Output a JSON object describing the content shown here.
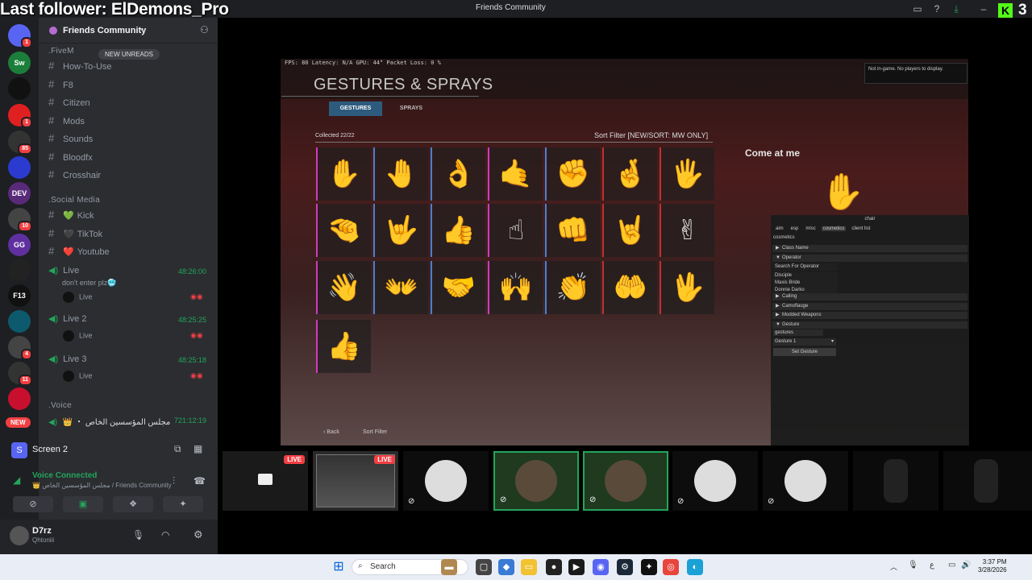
{
  "overlay": {
    "last_follower": "Last follower: ElDemons_Pro",
    "kick_count": "3"
  },
  "window": {
    "title": "Friends Community"
  },
  "guild": {
    "name": "Friends Community",
    "new_unreads": "NEW UNREADS"
  },
  "servers": [
    {
      "label": "",
      "badge": "1",
      "color": "#5865f2"
    },
    {
      "label": "Sw",
      "badge": "",
      "color": "#1b7f3b"
    },
    {
      "label": "",
      "badge": "",
      "color": "#111"
    },
    {
      "label": "",
      "badge": "1",
      "color": "#e02020"
    },
    {
      "label": "",
      "badge": "85",
      "color": "#333"
    },
    {
      "label": "",
      "badge": "",
      "color": "#2b3bd0"
    },
    {
      "label": "DEV",
      "badge": "",
      "color": "#5a2a7a"
    },
    {
      "label": "",
      "badge": "10",
      "color": "#444"
    },
    {
      "label": "GG",
      "badge": "",
      "color": "#6030a0"
    },
    {
      "label": "",
      "badge": "",
      "color": "#222"
    },
    {
      "label": "F13",
      "badge": "",
      "color": "#111"
    },
    {
      "label": "",
      "badge": "",
      "color": "#0d5a6e"
    },
    {
      "label": "",
      "badge": "4",
      "color": "#444"
    },
    {
      "label": "",
      "badge": "11",
      "color": "#333"
    },
    {
      "label": "",
      "badge": "",
      "color": "#c8102e"
    }
  ],
  "new_pill": "NEW",
  "categories": {
    "fivem": ".FiveM",
    "social": ".Social Media",
    "voice": ".Voice"
  },
  "fivem_channels": [
    "How-To-Use",
    "F8",
    "Citizen",
    "Mods",
    "Sounds",
    "Bloodfx",
    "Crosshair"
  ],
  "social_channels": [
    {
      "label": "Kick",
      "emoji": "💚"
    },
    {
      "label": "TikTok",
      "emoji": "🖤"
    },
    {
      "label": "Youtube",
      "emoji": "❤️"
    }
  ],
  "voice_channels": [
    {
      "name": "Live",
      "time": "48:26:00",
      "subtitle": "don't enter plz🥶",
      "member": "Live"
    },
    {
      "name": "Live 2",
      "time": "48:25:25",
      "subtitle": "",
      "member": "Live"
    },
    {
      "name": "Live 3",
      "time": "48:25:18",
      "subtitle": "",
      "member": "Live"
    }
  ],
  "voice_room": {
    "name": "👑 ・ مجلس المؤسسين الخاص",
    "time": "721:12:19"
  },
  "screen_panel": {
    "label": "Screen 2"
  },
  "voice_status": {
    "title": "Voice Connected",
    "channel": "👑 مجلس المؤسسين الخاص / Friends Community"
  },
  "user": {
    "name": "D7rz",
    "status": "Qhtoniii"
  },
  "game": {
    "hud": "FPS: 80    Latency: N/A    GPU: 44°    Packet Loss: 0 %",
    "title": "GESTURES & SPRAYS",
    "tabs": [
      "GESTURES",
      "SPRAYS"
    ],
    "collected": "Collected 22/22",
    "sort_filter": "Sort Filter [NEW/SORT: MW ONLY]",
    "selected_name": "Come at me",
    "status_box": "Not in-game. No players to display.",
    "back": "Back",
    "sort": "Sort Filter",
    "gesture_icons": [
      "✋",
      "🤚",
      "👌",
      "🤙",
      "✊",
      "🤞",
      "🖐",
      "🤏",
      "🤟",
      "👍",
      "☝",
      "👊",
      "🤘",
      "✌",
      "👋",
      "👐",
      "🤝",
      "🙌",
      "👏",
      "🤲",
      "🖖",
      "👍"
    ]
  },
  "cheat_menu": {
    "title": "chair",
    "tabs": [
      "aim",
      "esp",
      "misc",
      "cosmetics",
      "client list"
    ],
    "section": "cosmetics",
    "rows": [
      "Class Name",
      "Operator",
      "Search For Operator",
      "Disciple",
      "Maxis Bride",
      "Donnie Darko",
      "Calling",
      "Camoflauge",
      "Modded Weapons",
      "Gesture"
    ],
    "gesture_input": "gestures",
    "gesture_select": "Gesture 1",
    "set_button": "Set Gesture"
  },
  "thumbnails": [
    {
      "live": "LIVE",
      "kind": "screen"
    },
    {
      "live": "LIVE",
      "kind": "game"
    },
    {
      "live": "",
      "kind": "avatar"
    },
    {
      "live": "",
      "kind": "avatar"
    },
    {
      "live": "",
      "kind": "avatar"
    },
    {
      "live": "",
      "kind": "avatar"
    },
    {
      "live": "",
      "kind": "avatar"
    },
    {
      "live": "",
      "kind": "dark"
    },
    {
      "live": "",
      "kind": "dark"
    }
  ],
  "taskbar": {
    "search": "Search",
    "time": "3:37 PM",
    "date": "3/28/2026",
    "lang": "ع"
  }
}
